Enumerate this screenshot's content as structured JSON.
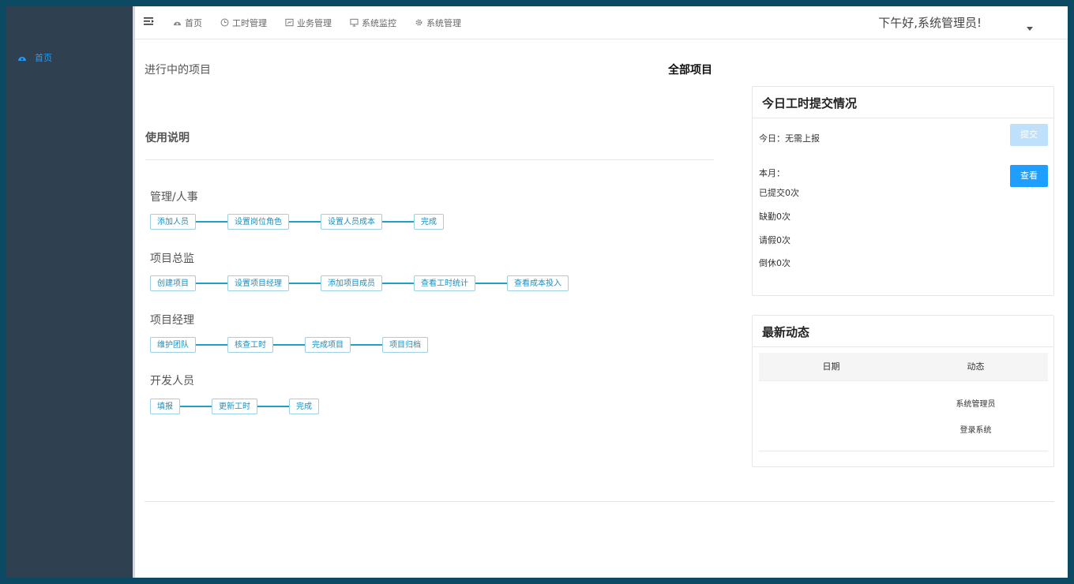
{
  "sidebar": {
    "items": [
      {
        "label": "首页",
        "icon": "dashboard-icon"
      }
    ]
  },
  "topbar": {
    "menu_icon": "hamburger-icon",
    "nav": [
      {
        "label": "首页",
        "icon": "dashboard-icon"
      },
      {
        "label": "工时管理",
        "icon": "clock-icon"
      },
      {
        "label": "业务管理",
        "icon": "briefcase-icon"
      },
      {
        "label": "系统监控",
        "icon": "monitor-icon"
      },
      {
        "label": "系统管理",
        "icon": "gear-icon"
      }
    ],
    "greeting": "下午好,系统管理员!"
  },
  "content": {
    "ongoing_title": "进行中的项目",
    "all_projects": "全部项目",
    "usage_title": "使用说明",
    "roles": [
      {
        "name": "管理/人事",
        "steps": [
          "添加人员",
          "设置岗位角色",
          "设置人员成本",
          "完成"
        ]
      },
      {
        "name": "项目总监",
        "steps": [
          "创建项目",
          "设置项目经理",
          "添加项目成员",
          "查看工时统计",
          "查看成本投入"
        ]
      },
      {
        "name": "项目经理",
        "steps": [
          "维护团队",
          "核查工时",
          "完成项目",
          "项目归档"
        ]
      },
      {
        "name": "开发人员",
        "steps": [
          "填报",
          "更新工时",
          "完成"
        ]
      }
    ]
  },
  "workhours_panel": {
    "title": "今日工时提交情况",
    "today": "今日：无需上报",
    "submit_button": "提交",
    "month_label": "本月：",
    "view_button": "查看",
    "submitted": "已提交0次",
    "absent": "缺勤0次",
    "leave": "请假0次",
    "off": "倒休0次"
  },
  "activity_panel": {
    "title": "最新动态",
    "columns": [
      "日期",
      "动态"
    ],
    "rows": [
      {
        "date": "",
        "user": "系统管理员",
        "action": "登录系统"
      }
    ]
  },
  "colors": {
    "sidebar_bg": "#2f4050",
    "accent": "#1e9fff",
    "flow_line": "#1fa0c9",
    "outer_bg": "#0c4a63"
  }
}
